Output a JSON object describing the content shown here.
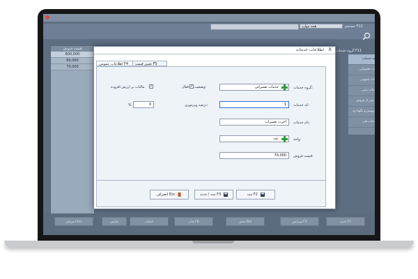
{
  "app": {
    "search_label": "جستجو F12",
    "search_select": "همه موارد",
    "group_label": "گروه خدمات F11"
  },
  "table": {
    "header": "قیمت فروش",
    "rows": [
      "800,000",
      "60,000",
      "70,000"
    ]
  },
  "right_list": {
    "items": [
      {
        "label": "کلیه خدمات"
      },
      {
        "label": "خدمات تعمیراتی"
      },
      {
        "label": "خدمات عمومی"
      },
      {
        "label": "خدمات مس"
      },
      {
        "label": "خدمات پس از فروش"
      },
      {
        "label": "خدمات سرویس و نگهداری"
      },
      {
        "label": "خدمات فنی"
      }
    ]
  },
  "bottom_buttons": {
    "new": "جدید F2",
    "edit": "ویرایش F3",
    "delete": "حذف Del",
    "print": "چاپ F8",
    "select": "انتخاب",
    "show": "نمایش",
    "exit": "انصراف Esc"
  },
  "dialog": {
    "title": "اطلاعات خدمات",
    "close": "X",
    "tabs": {
      "general": "اطلاعات عمومی F4",
      "price": "تعیین قیمت F5"
    },
    "labels": {
      "service_group": "گروه خدمات:",
      "status": "وضعیت:",
      "active": "فعال",
      "vat": "مالیات بر ارزش افزوده",
      "service_code": "کد خدمات:",
      "visitor_percent": "درصد ویزیتوری:",
      "percent_sign": "%",
      "service_name": "نام خدمات:",
      "unit": "واحد:",
      "sale_price": "قیمت فروش:"
    },
    "values": {
      "service_group": "خدمات تعمیراتی",
      "service_code": "1",
      "visitor_percent": "0",
      "service_name": "اجرت تعمیرات",
      "unit": "عدد",
      "sale_price": "70,000",
      "active_checked": "✓",
      "vat_checked": "✓"
    },
    "buttons": {
      "save": "ثبت F2",
      "save_new": "ثبت / جدید F3",
      "cancel": "انصراف Esc"
    }
  },
  "colors": {
    "accent_green": "#2e9b3a",
    "screen_bg": "#5e6e82",
    "dialog_bg": "#eef3f8"
  }
}
